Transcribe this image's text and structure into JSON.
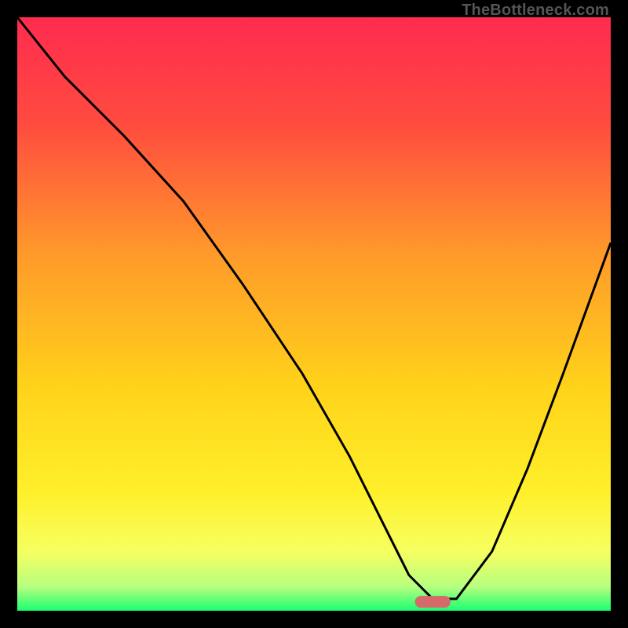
{
  "watermark": "TheBottleneck.com",
  "chart_data": {
    "type": "line",
    "title": "",
    "xlabel": "",
    "ylabel": "",
    "xlim": [
      0,
      100
    ],
    "ylim": [
      0,
      100
    ],
    "grid": false,
    "legend": false,
    "background": {
      "description": "smooth vertical gradient from red at top through orange and yellow to green at bottom, with a thin bright green strip along the very bottom",
      "stops": [
        {
          "y_pct": 0,
          "color": "#ff2b4f"
        },
        {
          "y_pct": 18,
          "color": "#ff4b3f"
        },
        {
          "y_pct": 40,
          "color": "#ff9a2a"
        },
        {
          "y_pct": 62,
          "color": "#ffd21a"
        },
        {
          "y_pct": 80,
          "color": "#fff02a"
        },
        {
          "y_pct": 90,
          "color": "#f6ff60"
        },
        {
          "y_pct": 96,
          "color": "#b7ff80"
        },
        {
          "y_pct": 100,
          "color": "#19ff70"
        }
      ]
    },
    "series": [
      {
        "name": "bottleneck-curve",
        "type": "line",
        "color": "#000000",
        "stroke_width": 3,
        "x": [
          0,
          8,
          18,
          28,
          38,
          48,
          56,
          62,
          66,
          70,
          74,
          80,
          86,
          92,
          100
        ],
        "y": [
          100,
          90,
          80,
          69,
          55,
          40,
          26,
          14,
          6,
          2,
          2,
          10,
          24,
          40,
          62
        ]
      },
      {
        "name": "highlight-marker",
        "type": "marker",
        "color": "#d66a6a",
        "shape": "rounded-bar",
        "x": 70,
        "y": 1.5,
        "width_pct": 6,
        "height_pct": 2
      }
    ]
  }
}
